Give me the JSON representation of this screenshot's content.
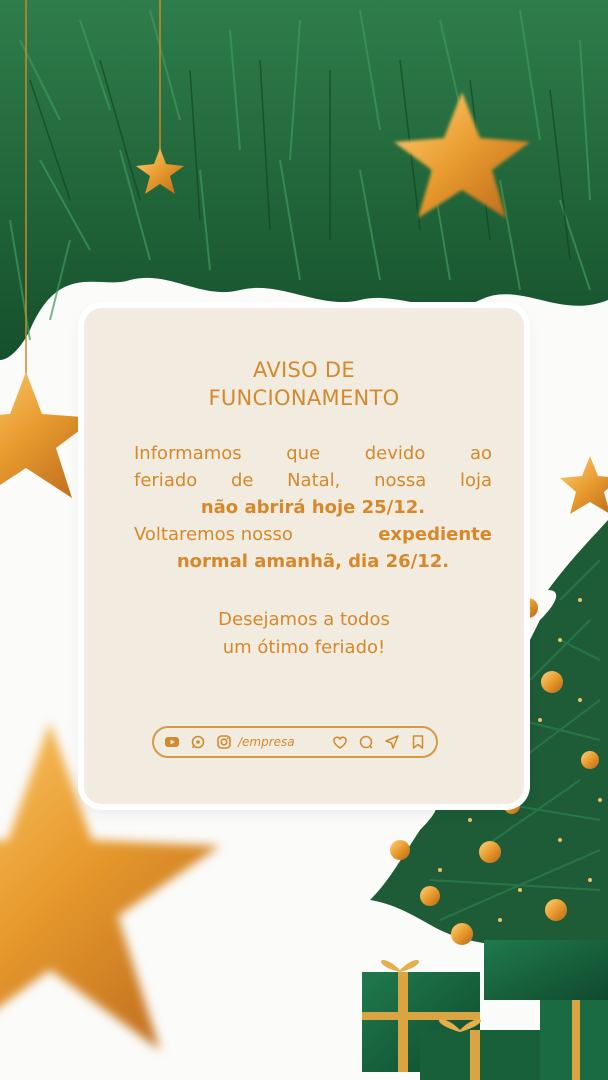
{
  "notice": {
    "title_line1": "AVISO DE",
    "title_line2": "FUNCIONAMENTO",
    "body": {
      "line1_words": [
        "Informamos",
        "que",
        "devido",
        "ao"
      ],
      "line2_words": [
        "feriado",
        "de",
        "Natal,",
        "nossa",
        "loja"
      ],
      "line3_bold": "não abrirá hoje 25/12.",
      "line4_plain": "Voltaremos nosso",
      "line4_bold": "expediente",
      "line5_bold": "normal amanhã, dia 26/12."
    },
    "closing_line1": "Desejamos a todos",
    "closing_line2": "um ótimo feriado!"
  },
  "social_bar": {
    "handle": "/empresa",
    "icons": [
      "youtube-icon",
      "whatsapp-icon",
      "instagram-icon",
      "heart-icon",
      "comment-icon",
      "send-icon",
      "bookmark-icon"
    ]
  },
  "colors": {
    "accent": "#d6882a",
    "card_bg": "#f2ebdf",
    "pine": "#1f6a3e",
    "gold": "#e8a43a"
  }
}
